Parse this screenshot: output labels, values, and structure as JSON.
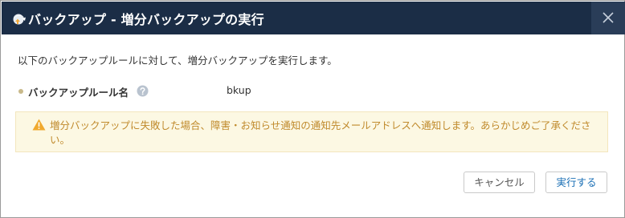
{
  "dialog": {
    "title": "バックアップ - 増分バックアップの実行",
    "close_glyph": "✕",
    "description": "以下のバックアップルールに対して、増分バックアップを実行します。",
    "field": {
      "label": "バックアップルール名",
      "value": "bkup"
    },
    "warning_text": "増分バックアップに失敗した場合、障害・お知らせ通知の通知先メールアドレスへ通知します。あらかじめご了承ください。",
    "buttons": {
      "cancel_label": "キャンセル",
      "run_label": "実行する"
    }
  },
  "icons": {
    "title": "backup-cloud-icon",
    "close": "close-icon",
    "help": "help-icon",
    "warning": "warning-icon"
  },
  "colors": {
    "titlebar": "#1b2d46",
    "warning_bg": "#fcf8e3",
    "warning_text": "#c08a2c",
    "primary_text": "#1a6fb5"
  }
}
